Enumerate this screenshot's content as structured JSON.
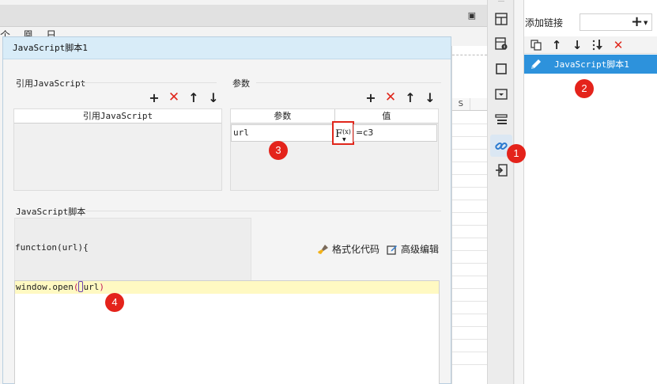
{
  "dialog": {
    "title": "JavaScript脚本1",
    "ref_section_label": "引用JavaScript",
    "ref_table_header": "引用JavaScript",
    "params_section_label": "参数",
    "params_headers": [
      "参数",
      "值"
    ],
    "param_row": {
      "name": "url",
      "fx_label": "F",
      "fx_sub": "(x)",
      "value": "=c3"
    },
    "script_section_label": "JavaScript脚本",
    "function_signature": "function(url){",
    "format_code_label": "格式化代码",
    "advanced_edit_label": "高级编辑",
    "code_line": {
      "prefix": "window.open",
      "open_paren": "(",
      "arg": "url",
      "close_paren": ")"
    }
  },
  "right_panel": {
    "add_link_label": "添加链接",
    "add_link_plus": "+",
    "list_items": [
      "JavaScript脚本1"
    ]
  },
  "background": {
    "sheet_column": "S",
    "toolbar_glyphs": "个 凰 日"
  },
  "badges": [
    "1",
    "2",
    "3",
    "4"
  ],
  "colors": {
    "accent_blue": "#2d92dc",
    "badge_red": "#e4231b",
    "delete_red": "#e0261b",
    "code_highlight": "#fff9c2",
    "dialog_title_bg": "#d8ecf8"
  },
  "icons": {
    "ref_toolbar": [
      "plus-icon",
      "delete-icon",
      "arrow-up-icon",
      "arrow-down-icon"
    ],
    "param_toolbar": [
      "plus-icon",
      "delete-icon",
      "arrow-up-icon",
      "arrow-down-icon"
    ],
    "right_toolbar": [
      "copy-icon",
      "arrow-up-icon",
      "arrow-down-icon",
      "sort-icon",
      "delete-icon"
    ],
    "vertical_toolbar": [
      "cell-attr-icon",
      "cell-info-icon",
      "frame-icon",
      "widget-icon",
      "stack-icon",
      "hyperlink-icon",
      "import-icon"
    ]
  }
}
